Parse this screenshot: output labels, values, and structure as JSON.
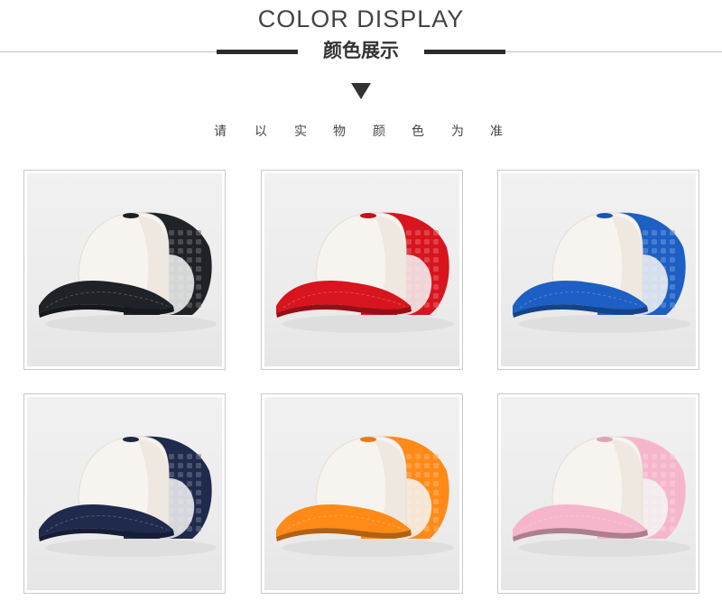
{
  "header": {
    "title": "COLOR DISPLAY",
    "subtitle": "颜色展示",
    "note_chars": [
      "请",
      "以",
      "实",
      "物",
      "颜",
      "色",
      "为",
      "准"
    ]
  },
  "colors": {
    "rule_dark": "#2b2b2b",
    "rule_light": "#bdbdbd",
    "triangle": "#333333"
  },
  "products": [
    {
      "name": "black-cap",
      "color": "#1f2226"
    },
    {
      "name": "red-cap",
      "color": "#d8141e"
    },
    {
      "name": "royal-blue-cap",
      "color": "#1d5fc4"
    },
    {
      "name": "navy-cap",
      "color": "#1f2a4d"
    },
    {
      "name": "orange-cap",
      "color": "#ff8a18"
    },
    {
      "name": "pink-cap",
      "color": "#f5b6cc"
    }
  ]
}
